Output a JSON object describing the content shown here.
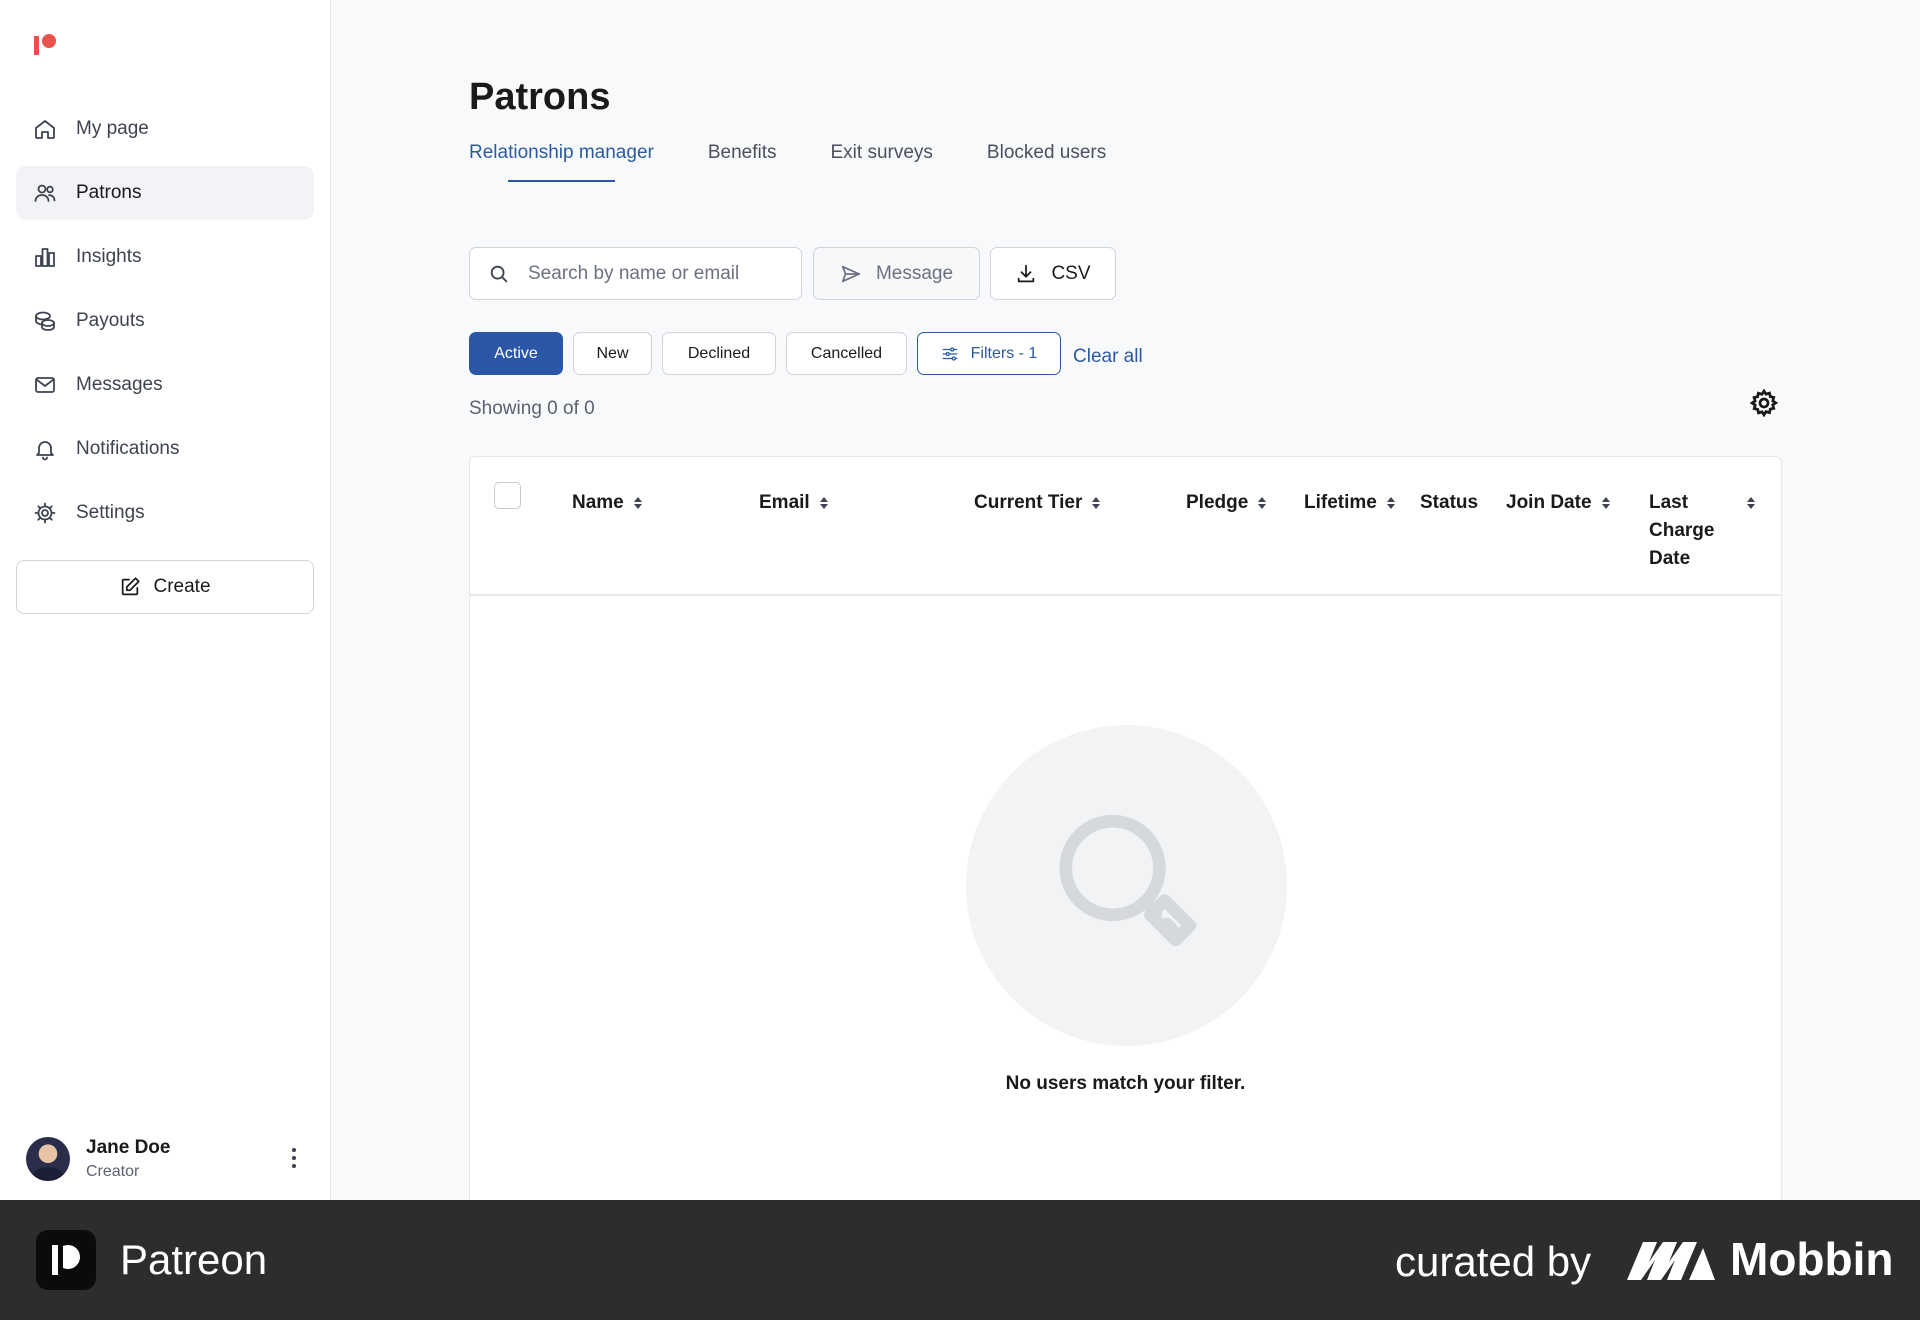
{
  "colors": {
    "brand": "#e8524a",
    "accent": "#2c5aa0",
    "active_chip": "#2c57a6",
    "footer_bg": "#2d2d2d"
  },
  "sidebar": {
    "logo_icon": "patreon-logo-icon",
    "items": [
      {
        "label": "My page",
        "icon": "home-icon",
        "active": false
      },
      {
        "label": "Patrons",
        "icon": "users-icon",
        "active": true
      },
      {
        "label": "Insights",
        "icon": "bar-chart-icon",
        "active": false
      },
      {
        "label": "Payouts",
        "icon": "coins-icon",
        "active": false
      },
      {
        "label": "Messages",
        "icon": "mail-icon",
        "active": false
      },
      {
        "label": "Notifications",
        "icon": "bell-icon",
        "active": false
      },
      {
        "label": "Settings",
        "icon": "gear-icon",
        "active": false
      }
    ],
    "create_label": "Create",
    "user": {
      "name": "Jane Doe",
      "role": "Creator"
    }
  },
  "main": {
    "title": "Patrons",
    "tabs": [
      {
        "label": "Relationship manager",
        "active": true
      },
      {
        "label": "Benefits",
        "active": false
      },
      {
        "label": "Exit surveys",
        "active": false
      },
      {
        "label": "Blocked users",
        "active": false
      }
    ],
    "search": {
      "placeholder": "Search by name or email",
      "value": ""
    },
    "message_label": "Message",
    "csv_label": "CSV",
    "chips": [
      {
        "label": "Active",
        "active": true
      },
      {
        "label": "New",
        "active": false
      },
      {
        "label": "Declined",
        "active": false
      },
      {
        "label": "Cancelled",
        "active": false
      }
    ],
    "filters_label": "Filters - 1",
    "clear_all_label": "Clear all",
    "showing_text": "Showing 0 of 0",
    "table": {
      "columns": [
        "Name",
        "Email",
        "Current Tier",
        "Pledge",
        "Lifetime",
        "Status",
        "Join Date",
        "Last Charge Date"
      ],
      "rows": [],
      "empty_text": "No users match your filter."
    }
  },
  "footer": {
    "brand_name": "Patreon",
    "curated_by": "curated by",
    "curator_name": "Mobbin"
  }
}
